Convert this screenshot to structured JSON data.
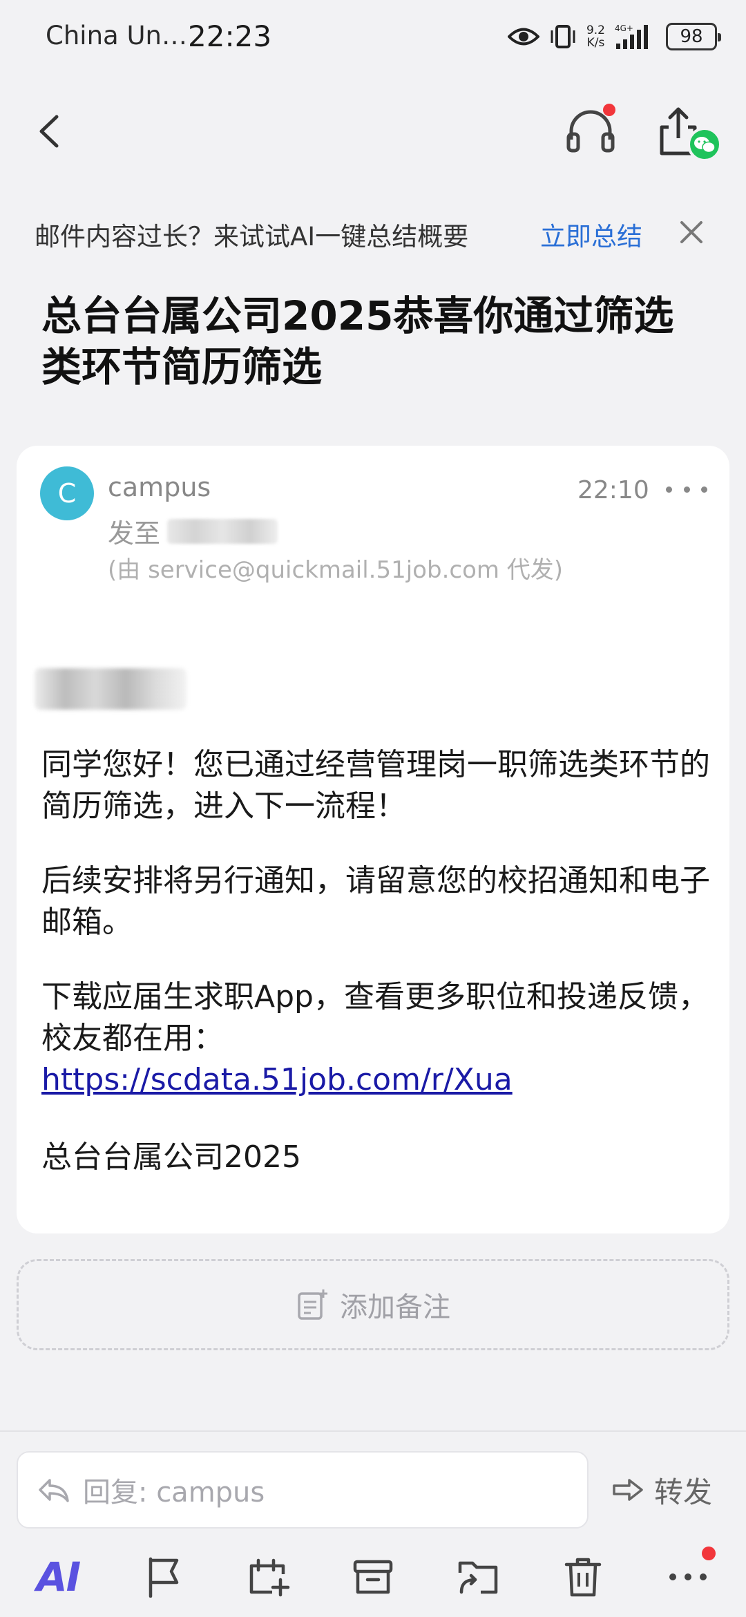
{
  "status_bar": {
    "carrier": "China Un…",
    "time": "22:23",
    "net_speed_value": "9.2",
    "net_speed_unit": "K/s",
    "network": "4G+",
    "battery": "98"
  },
  "nav": {
    "back_icon": "chevron-left-icon",
    "audio_icon": "headphones-icon",
    "share_icon": "share-icon",
    "wechat_icon": "wechat-icon"
  },
  "ai_banner": {
    "text": "邮件内容过长？来试试AI一键总结概要",
    "action": "立即总结",
    "accent": "#2a6fd6"
  },
  "email": {
    "subject": "总台台属公司2025恭喜你通过筛选类环节简历筛选",
    "avatar_letter": "C",
    "avatar_color": "#3fbbd6",
    "sender": "campus",
    "time": "22:10",
    "to_label": "发至",
    "proxy": "(由 service@quickmail.51job.com 代发)",
    "body": [
      "同学您好！您已通过经营管理岗一职筛选类环节的简历筛选，进入下一流程！",
      "后续安排将另行通知，请留意您的校招通知和电子邮箱。",
      "下载应届生求职App，查看更多职位和投递反馈，校友都在用："
    ],
    "link": "https://scdata.51job.com/r/Xua",
    "signature": "总台台属公司2025"
  },
  "add_note": {
    "label": "添加备注"
  },
  "bottom": {
    "reply_placeholder": "回复: campus",
    "forward": "转发",
    "ai_label": "AI",
    "tools": [
      "flag-icon",
      "calendar-add-icon",
      "archive-icon",
      "move-folder-icon",
      "trash-icon",
      "more-icon"
    ]
  }
}
